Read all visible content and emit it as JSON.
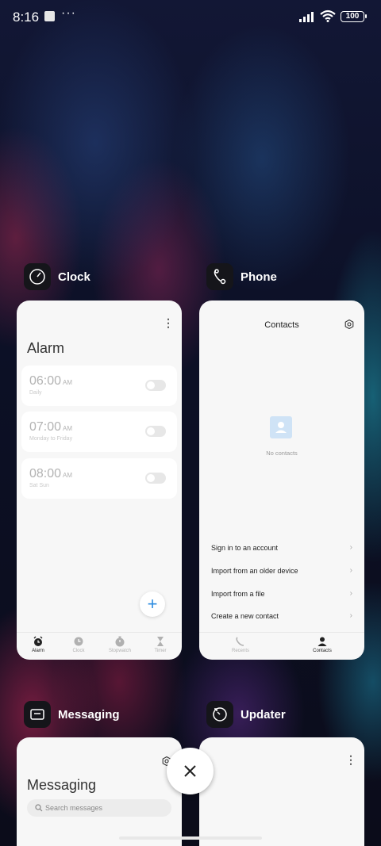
{
  "status_bar": {
    "time": "8:16",
    "more": "···",
    "battery": "100"
  },
  "apps": [
    {
      "name": "Clock",
      "icon": "clock-icon",
      "screen": {
        "title": "Alarm",
        "alarms": [
          {
            "time": "06:00",
            "ampm": "AM",
            "repeat": "Daily"
          },
          {
            "time": "07:00",
            "ampm": "AM",
            "repeat": "Monday to Friday"
          },
          {
            "time": "08:00",
            "ampm": "AM",
            "repeat": "Sat Sun"
          }
        ],
        "tabs": [
          "Alarm",
          "Clock",
          "Stopwatch",
          "Timer"
        ],
        "active_tab": "Alarm"
      }
    },
    {
      "name": "Phone",
      "icon": "phone-icon",
      "screen": {
        "title": "Contacts",
        "empty_text": "No contacts",
        "actions": [
          "Sign in to an account",
          "Import from an older device",
          "Import from a file",
          "Create a new contact"
        ],
        "tabs": [
          "Recents",
          "Contacts"
        ],
        "active_tab": "Contacts"
      }
    },
    {
      "name": "Messaging",
      "icon": "messaging-icon",
      "screen": {
        "title": "Messaging",
        "search_placeholder": "Search messages"
      }
    },
    {
      "name": "Updater",
      "icon": "updater-icon",
      "screen": {}
    }
  ],
  "colors": {
    "accent": "#2d8ce0",
    "card_bg": "#f7f7f7"
  }
}
